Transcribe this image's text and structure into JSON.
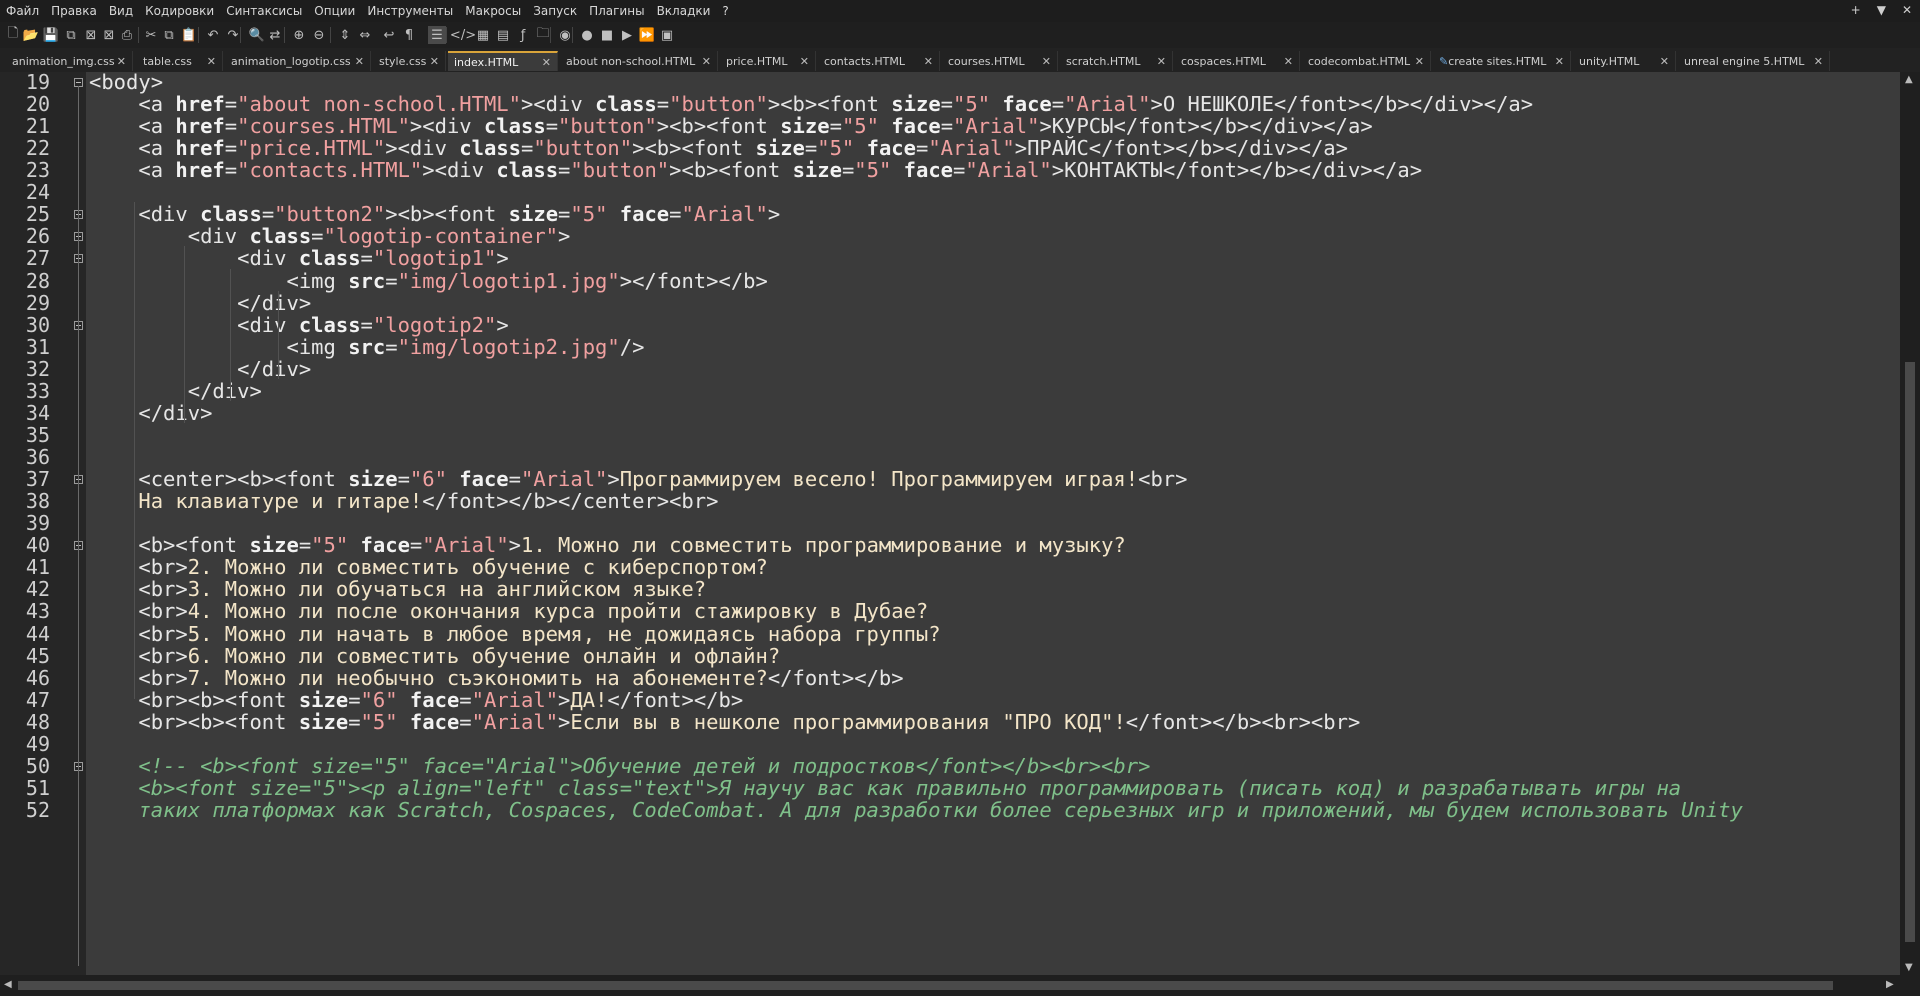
{
  "menu": [
    "Файл",
    "Правка",
    "Вид",
    "Кодировки",
    "Синтаксисы",
    "Опции",
    "Инструменты",
    "Макросы",
    "Запуск",
    "Плагины",
    "Вкладки",
    "?"
  ],
  "window_controls": [
    "+",
    "▼",
    "✕"
  ],
  "toolbar_icons": [
    "new-file-icon",
    "open-icon",
    "save-icon",
    "save-all-icon",
    "close-icon",
    "close-all-icon",
    "print-icon",
    "cut-icon",
    "copy-icon",
    "paste-icon",
    "undo-icon",
    "redo-icon",
    "find-icon",
    "replace-icon",
    "zoom-in-icon",
    "zoom-out-icon",
    "sync-v-icon",
    "sync-h-icon",
    "word-wrap-icon",
    "show-all-chars-icon",
    "indent-guide-icon",
    "html-tag-icon",
    "doc-map-icon",
    "doc-list-icon",
    "function-list-icon",
    "folder-workspace-icon",
    "monitoring-icon",
    "record-macro-icon",
    "stop-macro-icon",
    "play-macro-icon",
    "run-macro-multiple-icon",
    "save-macro-icon"
  ],
  "tabs": [
    {
      "label": "animation_img.css",
      "close": "✕"
    },
    {
      "label": "table.css",
      "close": "✕"
    },
    {
      "label": "animation_logotip.css",
      "close": "✕"
    },
    {
      "label": "style.css",
      "close": "✕"
    },
    {
      "label": "index.HTML",
      "close": "✕",
      "active": true
    },
    {
      "label": "about non-school.HTML",
      "close": "✕"
    },
    {
      "label": "price.HTML",
      "close": "✕"
    },
    {
      "label": "contacts.HTML",
      "close": "✕"
    },
    {
      "label": "courses.HTML",
      "close": "✕"
    },
    {
      "label": "scratch.HTML",
      "close": "✕"
    },
    {
      "label": "cospaces.HTML",
      "close": "✕"
    },
    {
      "label": "codecombat.HTML",
      "close": "✕"
    },
    {
      "label": "create sites.HTML",
      "close": "✕"
    },
    {
      "label": "unity.HTML",
      "close": "✕"
    },
    {
      "label": "unreal engine 5.HTML",
      "close": "✕"
    }
  ],
  "line_numbers": [
    "19",
    "20",
    "21",
    "22",
    "23",
    "24",
    "25",
    "26",
    "27",
    "28",
    "29",
    "30",
    "31",
    "32",
    "33",
    "34",
    "35",
    "36",
    "37",
    "38",
    "39",
    "40",
    "41",
    "42",
    "43",
    "44",
    "45",
    "46",
    "47",
    "48",
    "49",
    "50",
    "51",
    "52"
  ],
  "code": {
    "l19": [
      "<body>"
    ],
    "l20": [
      "    <a ",
      "href",
      "=",
      "\"about non-school.HTML\"",
      "><div ",
      "class",
      "=",
      "\"button\"",
      "><b><font ",
      "size",
      "=",
      "\"5\"",
      " ",
      "face",
      "=",
      "\"Arial\"",
      ">О НЕШКОЛЕ</font></b></div></a>"
    ],
    "l21": [
      "    <a ",
      "href",
      "=",
      "\"courses.HTML\"",
      "><div ",
      "class",
      "=",
      "\"button\"",
      "><b><font ",
      "size",
      "=",
      "\"5\"",
      " ",
      "face",
      "=",
      "\"Arial\"",
      ">КУРСЫ</font></b></div></a>"
    ],
    "l22": [
      "    <a ",
      "href",
      "=",
      "\"price.HTML\"",
      "><div ",
      "class",
      "=",
      "\"button\"",
      "><b><font ",
      "size",
      "=",
      "\"5\"",
      " ",
      "face",
      "=",
      "\"Arial\"",
      ">ПРАЙС</font></b></div></a>"
    ],
    "l23": [
      "    <a ",
      "href",
      "=",
      "\"contacts.HTML\"",
      "><div ",
      "class",
      "=",
      "\"button\"",
      "><b><font ",
      "size",
      "=",
      "\"5\"",
      " ",
      "face",
      "=",
      "\"Arial\"",
      ">КОНТАКТЫ</font></b></div></a>"
    ],
    "l25": [
      "    <div ",
      "class",
      "=",
      "\"button2\"",
      "><b><font ",
      "size",
      "=",
      "\"5\"",
      " ",
      "face",
      "=",
      "\"Arial\"",
      ">"
    ],
    "l26": [
      "        <div ",
      "class",
      "=",
      "\"logotip-container\"",
      ">"
    ],
    "l27": [
      "            <div ",
      "class",
      "=",
      "\"logotip1\"",
      ">"
    ],
    "l28": [
      "                <img ",
      "src",
      "=",
      "\"img/logotip1.jpg\"",
      "></font></b>"
    ],
    "l29": [
      "            </div>"
    ],
    "l30": [
      "            <div ",
      "class",
      "=",
      "\"logotip2\"",
      ">"
    ],
    "l31": [
      "                <img ",
      "src",
      "=",
      "\"img/logotip2.jpg\"",
      "/>"
    ],
    "l32": [
      "            </div>"
    ],
    "l33": [
      "        </div>"
    ],
    "l34": [
      "    </div>"
    ],
    "l37": [
      "    <center><b><font ",
      "size",
      "=",
      "\"6\"",
      " ",
      "face",
      "=",
      "\"Arial\"",
      ">",
      "Программируем весело! Программируем играя!",
      "<br>"
    ],
    "l38": [
      "    ",
      "На клавиатуре и гитаре!",
      "</font></b></center><br>"
    ],
    "l40": [
      "    <b><font ",
      "size",
      "=",
      "\"5\"",
      " ",
      "face",
      "=",
      "\"Arial\"",
      ">",
      "1. Можно ли совместить программирование и музыку?"
    ],
    "l41": [
      "    <br>",
      "2. Можно ли совместить обучение с киберспортом?"
    ],
    "l42": [
      "    <br>",
      "3. Можно ли обучаться на английском языке?"
    ],
    "l43": [
      "    <br>",
      "4. Можно ли после окончания курса пройти стажировку в Дубае?"
    ],
    "l44": [
      "    <br>",
      "5. Можно ли начать в любое время, не дожидаясь набора группы?"
    ],
    "l45": [
      "    <br>",
      "6. Можно ли совместить обучение онлайн и офлайн?"
    ],
    "l46": [
      "    <br>",
      "7. Можно ли необычно съэкономить на абонементе?",
      "</font></b>"
    ],
    "l47": [
      "    <br><b><font ",
      "size",
      "=",
      "\"6\"",
      " ",
      "face",
      "=",
      "\"Arial\"",
      ">",
      "ДА!",
      "</font></b>"
    ],
    "l48": [
      "    <br><b><font ",
      "size",
      "=",
      "\"5\"",
      " ",
      "face",
      "=",
      "\"Arial\"",
      ">",
      "Если вы в нешколе программирования \"ПРО КОД\"!",
      "</font></b><br><br>"
    ],
    "l50": [
      "    <!-- <b><font size=\"5\" face=\"Arial\">Обучение детей и подростков</font></b><br><br>"
    ],
    "l51": [
      "    <b><font size=\"5\"><p align=\"left\" class=\"text\">Я научу вас как правильно программировать (писать код) и разрабатывать игры на"
    ],
    "l52": [
      "    таких платформах как Scratch, Cospaces, CodeCombat. А для разработки более серьезных игр и приложений, мы будем использовать Unity"
    ]
  }
}
